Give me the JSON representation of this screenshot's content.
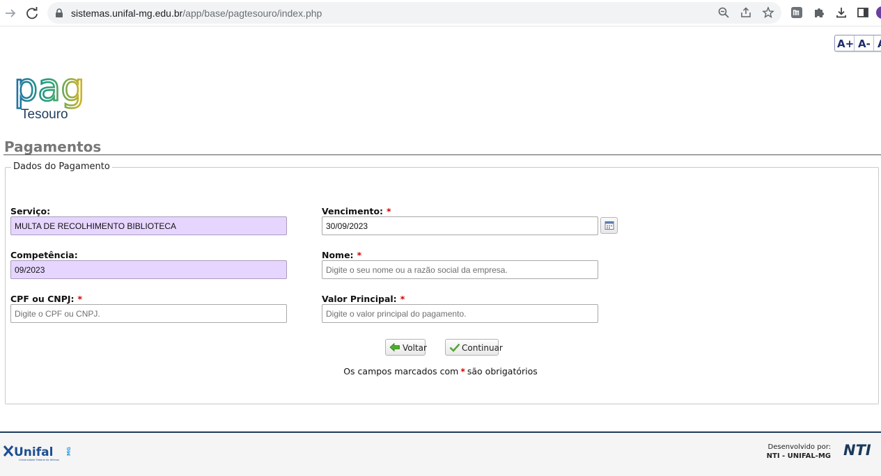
{
  "browser": {
    "url_host": "sistemas.unifal-mg.edu.br",
    "url_path": "/app/base/pagtesouro/index.php"
  },
  "font_tools": {
    "increase": "A+",
    "decrease": "A-",
    "reset": "A"
  },
  "logo": {
    "big": "pag",
    "small": "Tesouro"
  },
  "page": {
    "title": "Pagamentos"
  },
  "form": {
    "legend": "Dados do Pagamento",
    "required_mark": "*",
    "servico": {
      "label": "Serviço:",
      "value": "MULTA DE RECOLHIMENTO BIBLIOTECA"
    },
    "vencimento": {
      "label": "Vencimento:",
      "value": "30/09/2023"
    },
    "competencia": {
      "label": "Competência:",
      "value": "09/2023"
    },
    "nome": {
      "label": "Nome:",
      "placeholder": "Digite o seu nome ou a razão social da empresa."
    },
    "cpf": {
      "label": "CPF ou CNPJ:",
      "placeholder": "Digite o CPF ou CNPJ."
    },
    "valor": {
      "label": "Valor Principal:",
      "placeholder": "Digite o valor principal do pagamento."
    },
    "buttons": {
      "back": "Voltar",
      "continue": "Continuar"
    },
    "required_note_before": "Os campos marcados com",
    "required_note_after": "são obrigatórios"
  },
  "footer": {
    "unifal_logo_text": "Unifal",
    "unifal_logo_mg": "MG",
    "unifal_logo_sub": "Universidade Federal de Alfenas",
    "developed_by": "Desenvolvido por:",
    "developer": "NTI - UNIFAL-MG",
    "nti_logo_text": "NTI"
  },
  "colors": {
    "readonly_field": "#e6d6ff",
    "required": "#d10000",
    "footer_rule": "#1b3a5c",
    "title": "#777777"
  }
}
